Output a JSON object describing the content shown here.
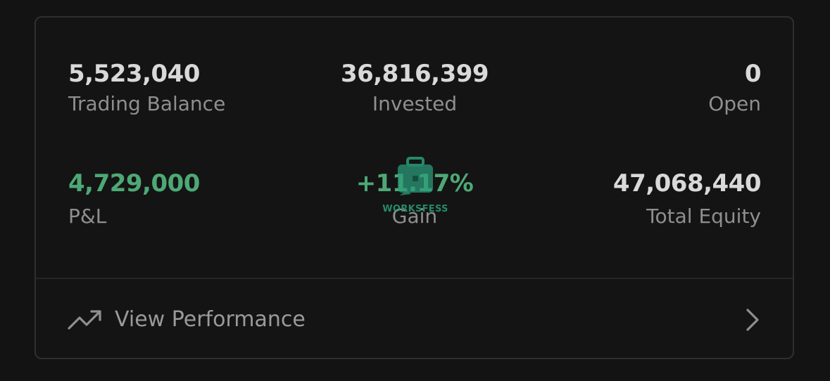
{
  "stats": {
    "trading_balance": {
      "value": "5,523,040",
      "label": "Trading Balance"
    },
    "invested": {
      "value": "36,816,399",
      "label": "Invested"
    },
    "open": {
      "value": "0",
      "label": "Open"
    },
    "pnl": {
      "value": "4,729,000",
      "label": "P&L"
    },
    "gain": {
      "value": "+11.17%",
      "label": "Gain"
    },
    "total_equity": {
      "value": "47,068,440",
      "label": "Total Equity"
    }
  },
  "performance": {
    "label": "View Performance",
    "icon": "trending-up-icon",
    "chevron_icon": "chevron-right-icon"
  },
  "watermark": {
    "text": "WORKSFESS"
  },
  "colors": {
    "background": "#131313",
    "card_border": "#2f2f2f",
    "value_text": "#d9d9d9",
    "label_text": "#8f8f8f",
    "positive": "#4ea876",
    "watermark": "#2a9d7a"
  }
}
